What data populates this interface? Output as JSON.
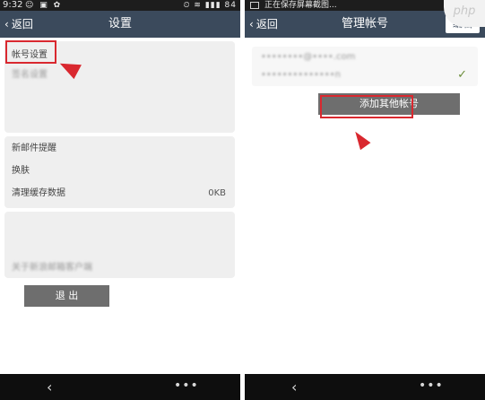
{
  "left_screen": {
    "status": {
      "time": "9:32",
      "left_icons": "☺ ▣ ✿",
      "right_icons": "⏲ ≋ ▮▮▮ 84"
    },
    "title_bar": {
      "back_label": "返回",
      "title": "设置"
    },
    "card1": {
      "account_settings": "帐号设置",
      "second_item": "签名设置"
    },
    "card2": {
      "new_mail_reminder": "新邮件提醒",
      "skin": "换肤",
      "clear_cache": "清理缓存数据",
      "cache_size": "0KB"
    },
    "card3": {
      "about": "关于新浪邮箱客户端"
    },
    "logout_label": "退 出"
  },
  "right_screen": {
    "status": {
      "text": "正在保存屏幕截图..."
    },
    "title_bar": {
      "back_label": "返回",
      "title": "管理帐号",
      "edit_label": "编辑"
    },
    "accounts": [
      {
        "address": "••••••••@••••.com"
      },
      {
        "address": "••••••••••••••n"
      }
    ],
    "add_account_label": "添加其他帐号"
  },
  "watermark": "php",
  "colors": {
    "title_bar": "#3b4a5c",
    "highlight": "#d9282f",
    "button": "#6e6e6e",
    "check": "#6c8d3b"
  }
}
